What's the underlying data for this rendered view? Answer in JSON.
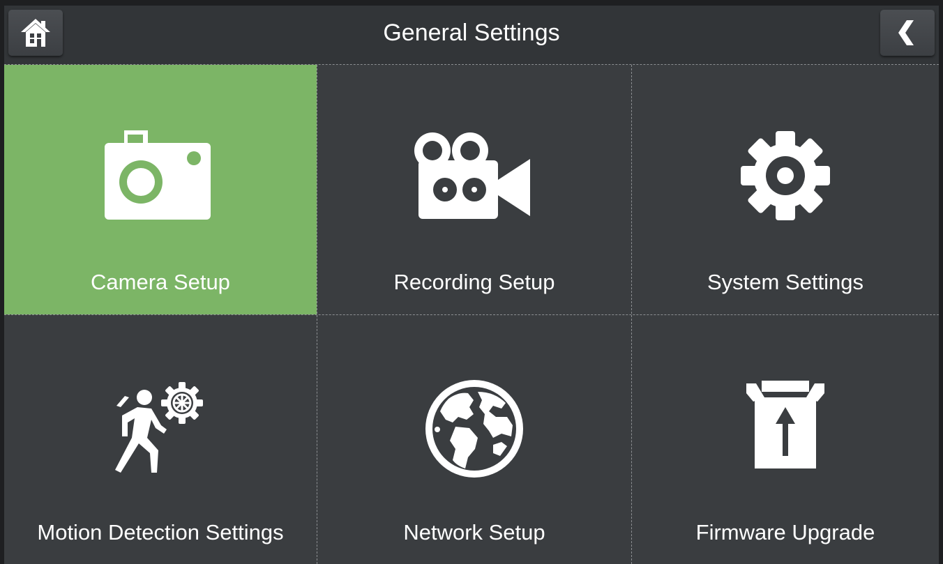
{
  "header": {
    "title": "General Settings",
    "home_icon": "home-icon",
    "back_icon": "chevron-left-icon"
  },
  "colors": {
    "background": "#3a3d40",
    "header": "#323538",
    "selected": "#7cb566",
    "text": "#ffffff"
  },
  "tiles": [
    {
      "label": "Camera Setup",
      "icon": "camera-icon",
      "selected": true
    },
    {
      "label": "Recording Setup",
      "icon": "video-camera-icon",
      "selected": false
    },
    {
      "label": "System Settings",
      "icon": "gear-icon",
      "selected": false
    },
    {
      "label": "Motion Detection Settings",
      "icon": "motion-detection-icon",
      "selected": false
    },
    {
      "label": "Network Setup",
      "icon": "globe-icon",
      "selected": false
    },
    {
      "label": "Firmware Upgrade",
      "icon": "firmware-upgrade-icon",
      "selected": false
    }
  ]
}
